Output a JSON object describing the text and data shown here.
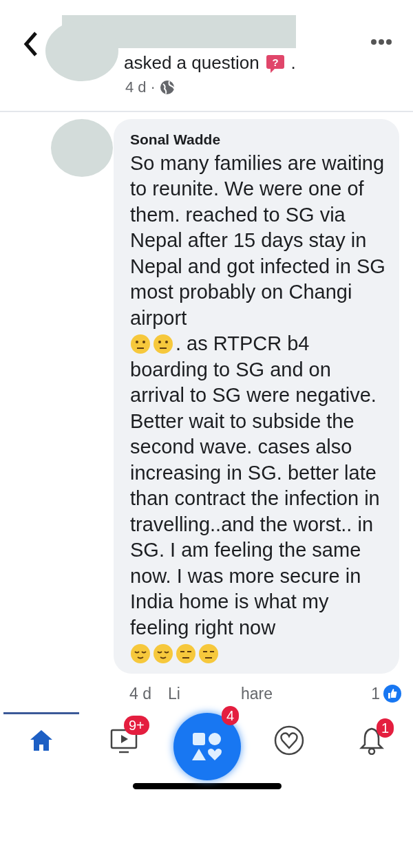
{
  "header": {
    "action": "asked a question",
    "question_mark": "?",
    "after_icon": ".",
    "time": "4 d",
    "separator": "·"
  },
  "comment": {
    "author": "Sonal Wadde",
    "text_1": "So many families are waiting to reunite. We were one of them. reached to SG via Nepal after 15 days stay in Nepal and got infected in SG most probably on Changi airport",
    "emojis_1": [
      {
        "kind": "neutral"
      },
      {
        "kind": "neutral"
      }
    ],
    "text_2": ". as RTPCR b4",
    "text_3": "boarding to SG and on arrival to SG were negative. Better wait to subside the second wave. cases also increasing in SG. better late than contract the infection in travelling..and the worst.. in SG. I am feeling the same now. I was more secure in India home is what my feeling right now",
    "emojis_2": [
      {
        "kind": "relieved"
      },
      {
        "kind": "relieved"
      },
      {
        "kind": "expressionless"
      },
      {
        "kind": "expressionless"
      }
    ],
    "time": "4 d",
    "like": "Li",
    "share": "hare",
    "reaction_count": "1"
  },
  "tabs": [
    {
      "selected": true
    },
    {
      "selected": false,
      "badge": "9+"
    },
    {
      "selected": false,
      "badge": "4"
    },
    {
      "selected": false
    },
    {
      "selected": false,
      "badge": "1"
    }
  ]
}
